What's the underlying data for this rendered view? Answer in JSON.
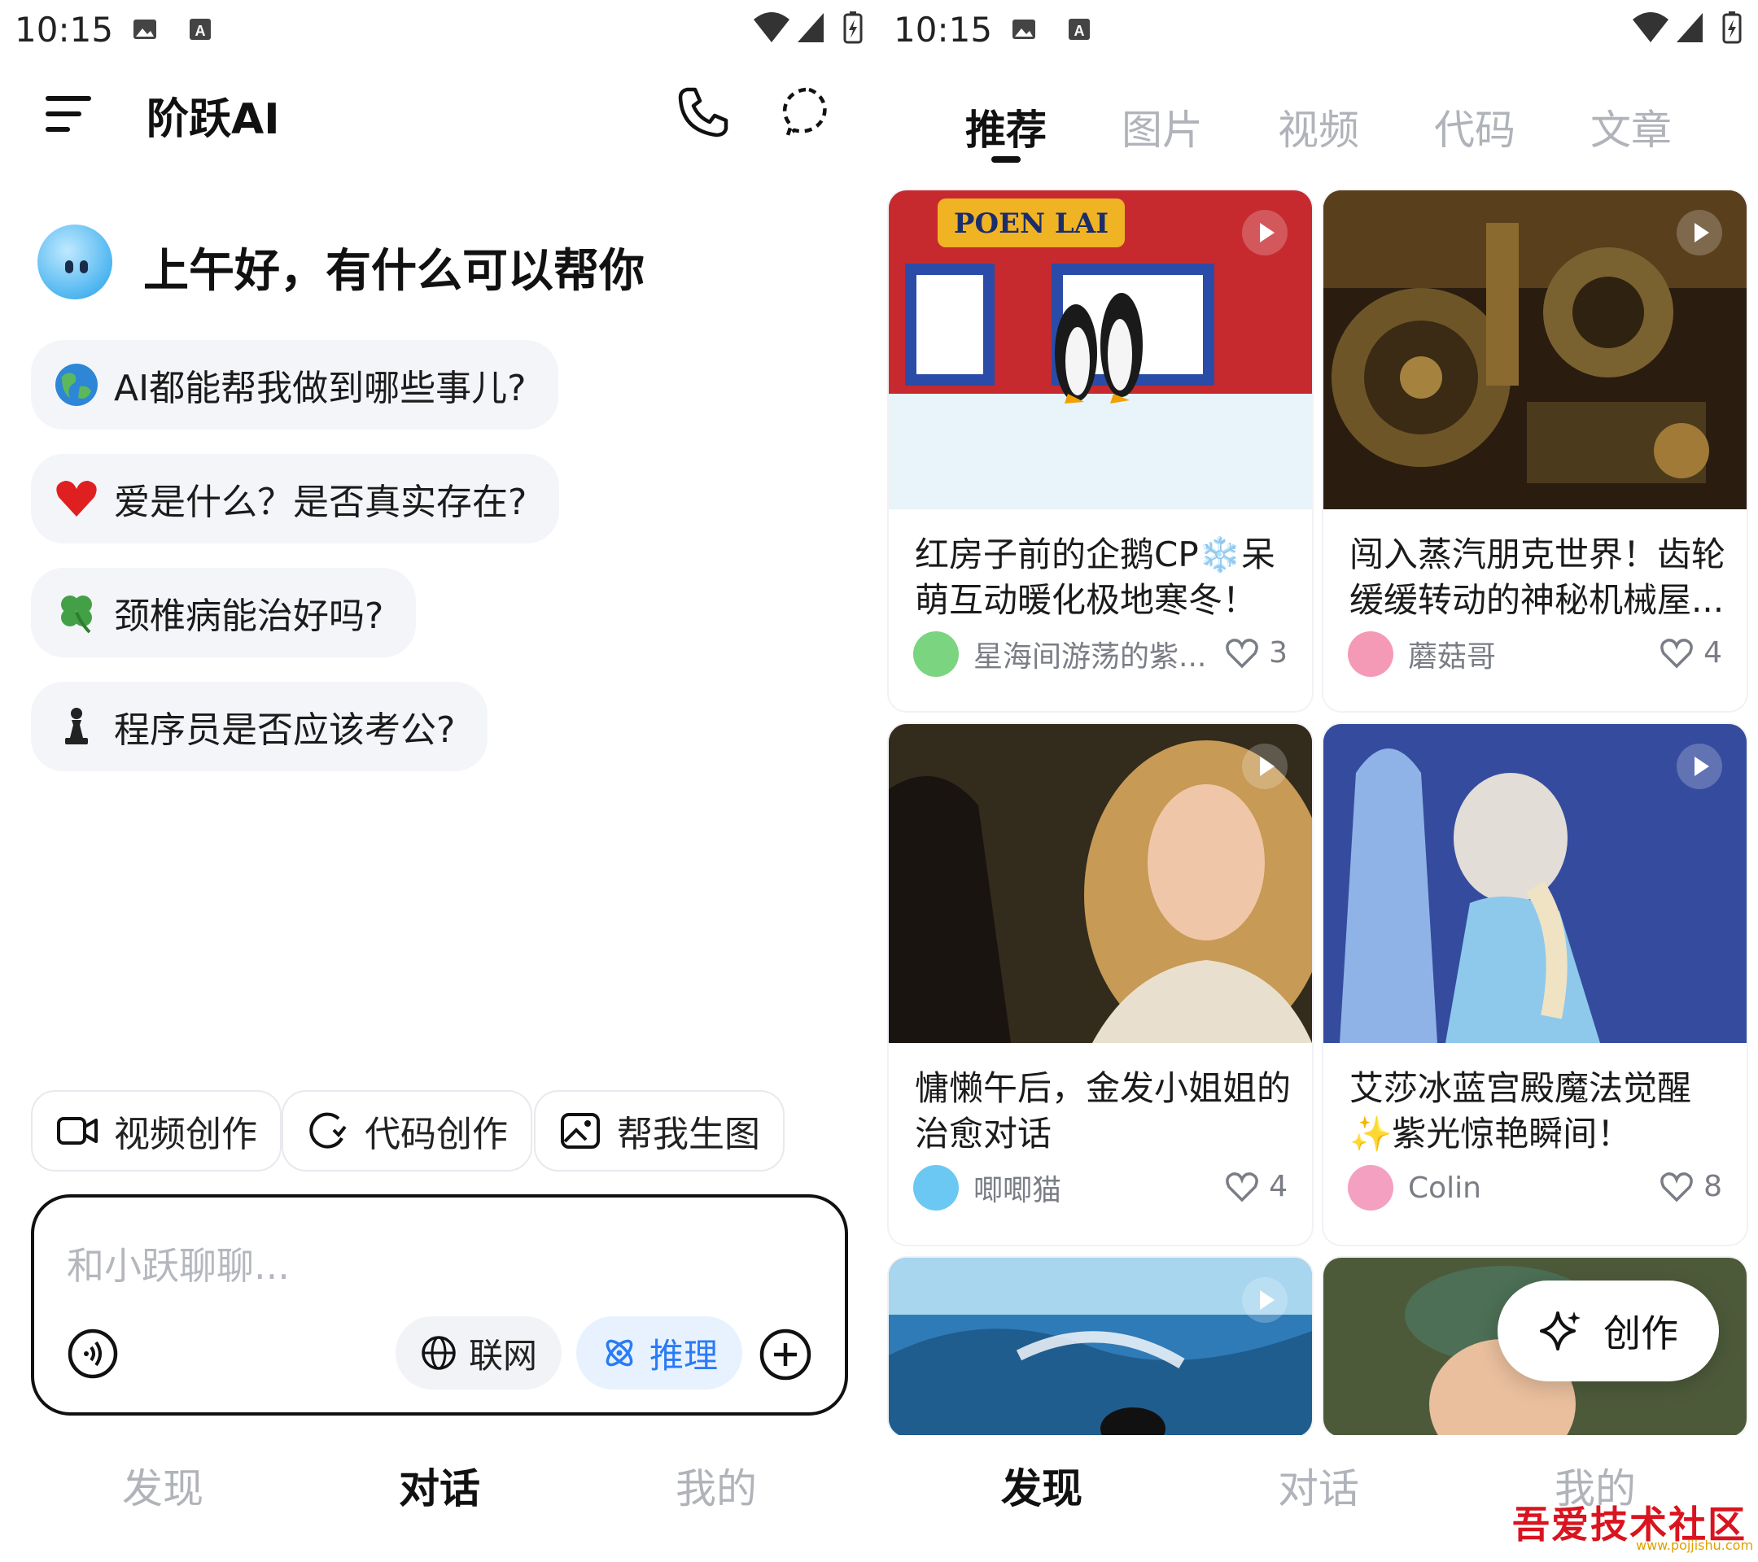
{
  "left": {
    "status": {
      "time": "10:15"
    },
    "header": {
      "title": "阶跃AI"
    },
    "greeting": "上午好，有什么可以帮你",
    "suggestions": [
      {
        "icon": "globe-icon",
        "text": "AI都能帮我做到哪些事儿?"
      },
      {
        "icon": "heart-icon",
        "text": "爱是什么？是否真实存在?"
      },
      {
        "icon": "clover-icon",
        "text": "颈椎病能治好吗?"
      },
      {
        "icon": "chess-pawn-icon",
        "text": "程序员是否应该考公?"
      }
    ],
    "chips": [
      "视频创作",
      "代码创作",
      "帮我生图"
    ],
    "input": {
      "placeholder": "和小跃聊聊..."
    },
    "pills": {
      "web": "联网",
      "reason": "推理"
    },
    "nav": {
      "discover": "发现",
      "chat": "对话",
      "mine": "我的",
      "active": "chat"
    },
    "colors": {
      "accent": "#2a7bf6",
      "pill_active_bg": "#e8f2ff",
      "chip_border": "#e8e9ee"
    }
  },
  "right": {
    "status": {
      "time": "10:15"
    },
    "tabs": [
      "推荐",
      "图片",
      "视频",
      "代码",
      "文章"
    ],
    "active_tab": "推荐",
    "cards": [
      {
        "title": "红房子前的企鹅CP❄️呆萌互动暖化极地寒冬！",
        "author": "星海间游荡的紫...",
        "likes": "3"
      },
      {
        "title": "闯入蒸汽朋克世界！齿轮缓缓转动的神秘机械屋...",
        "author": "蘑菇哥",
        "likes": "4"
      },
      {
        "title": "慵懒午后，金发小姐姐的治愈对话",
        "author": "唧唧猫",
        "likes": "4"
      },
      {
        "title": "艾莎冰蓝宫殿魔法觉醒✨紫光惊艳瞬间！",
        "author": "Colin",
        "likes": "8"
      }
    ],
    "thumb_sign": "POEN LAI",
    "create_button": "创作",
    "nav": {
      "discover": "发现",
      "chat": "对话",
      "mine": "我的",
      "active": "discover"
    },
    "watermark": "吾爱技术社区",
    "watermark_url": "www.pojjishu.com"
  }
}
